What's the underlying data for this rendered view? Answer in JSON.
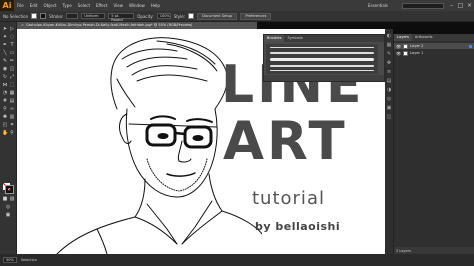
{
  "app": {
    "logo": "Ai"
  },
  "menu": [
    "File",
    "Edit",
    "Object",
    "Type",
    "Select",
    "Effect",
    "View",
    "Window",
    "Help"
  ],
  "workspace": "Essentials",
  "control": {
    "selection_label": "No Selection",
    "stroke_label": "Stroke:",
    "stroke_value": "",
    "brush_def": "Uniform",
    "brush_size": "5 pt. Round",
    "opacity_label": "Opacity:",
    "opacity_value": "100%",
    "style_label": "Style:",
    "doc_setup": "Document Setup",
    "preferences": "Preferences"
  },
  "document": {
    "tab_title": "Cashulan-Khyan-Kriliku-Dimiryo-Pemah-Dr-Kelly-fsati-Mesih-fafridah.jpg* @ 50% (RGB/Preview)"
  },
  "artwork": {
    "title_line1": "LINE",
    "title_line2": "ART",
    "subtitle": "tutorial",
    "byline": "by bellaoishi"
  },
  "brush_panel": {
    "tabs": [
      "Brushes",
      "Symbols"
    ]
  },
  "layers_panel": {
    "tabs": [
      "Layers",
      "Artboards"
    ],
    "layers": [
      {
        "name": "Layer 2",
        "selected": true
      },
      {
        "name": "Layer 1",
        "selected": false
      }
    ],
    "count": "2 Layers"
  },
  "status": {
    "zoom": "50%",
    "tool": "Selection"
  },
  "colors": {
    "accent": "#ff9a00",
    "layer_color": "#4a7fff"
  }
}
